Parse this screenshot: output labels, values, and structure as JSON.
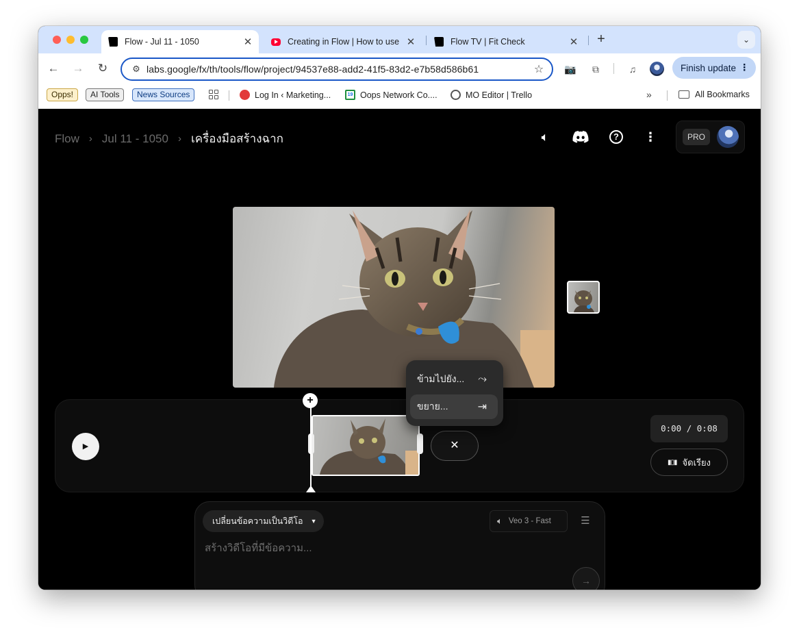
{
  "browser": {
    "tabs": [
      {
        "title": "Flow - Jul 11 - 1050",
        "active": true
      },
      {
        "title": "Creating in Flow | How to use",
        "active": false
      },
      {
        "title": "Flow TV | Fit Check",
        "active": false
      }
    ],
    "tab_close_glyph": "✕",
    "new_tab_glyph": "+",
    "url": "labs.google/fx/th/tools/flow/project/94537e88-add2-41f5-83d2-e7b58d586b61",
    "finish_update_label": "Finish update",
    "bookmarks": {
      "chips": [
        "Opps!",
        "AI Tools",
        "News Sources"
      ],
      "links": [
        "Log In ‹ Marketing...",
        "Oops Network Co....",
        "MO Editor | Trello"
      ],
      "calendar_icon_text": "19",
      "overflow": "»",
      "all_bookmarks": "All Bookmarks"
    }
  },
  "app": {
    "breadcrumb": {
      "root": "Flow",
      "project": "Jul 11 - 1050",
      "current": "เครื่องมือสร้างฉาก"
    },
    "plan_badge": "PRO",
    "timeline": {
      "time_display": "0:00 / 0:08",
      "arrange_label": "จัดเรียง",
      "close_glyph": "✕",
      "plus_glyph": "+"
    },
    "context_menu": {
      "items": [
        "ข้ามไปยัง...",
        "ขยาย..."
      ]
    },
    "prompt": {
      "mode_label": "เปลี่ยนข้อความเป็นวิดีโอ",
      "model_label": "Veo 3 - Fast",
      "placeholder": "สร้างวิดีโอที่มีข้อความ..."
    },
    "icons": [
      "speaker-icon",
      "discord-icon",
      "help-icon",
      "more-vert-icon",
      "play-icon",
      "send-arrow-icon",
      "settings-sliders-icon"
    ]
  }
}
